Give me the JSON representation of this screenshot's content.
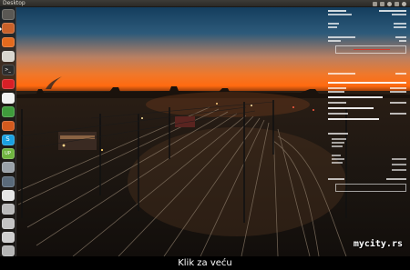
{
  "top_panel": {
    "title": "Desktop"
  },
  "launcher": {
    "icons": [
      {
        "name": "dash-home-icon",
        "glyph": "",
        "color": "#5a5854"
      },
      {
        "name": "files-icon",
        "glyph": "",
        "color": "#c8612a"
      },
      {
        "name": "firefox-icon",
        "glyph": "",
        "color": "#e36a1e"
      },
      {
        "name": "text-editor-icon",
        "glyph": "",
        "color": "#d9d6cf"
      },
      {
        "name": "terminal-icon",
        "glyph": ">_",
        "color": "#2c2c2c"
      },
      {
        "name": "opera-icon",
        "glyph": "",
        "color": "#d81f26"
      },
      {
        "name": "libreoffice-writer-icon",
        "glyph": "",
        "color": "#f2f2f2"
      },
      {
        "name": "libreoffice-calc-icon",
        "glyph": "",
        "color": "#3f9b3c"
      },
      {
        "name": "libreoffice-impress-icon",
        "glyph": "",
        "color": "#d35a1e"
      },
      {
        "name": "skype-icon",
        "glyph": "S",
        "color": "#1aa0e0"
      },
      {
        "name": "upwork-icon",
        "glyph": "UP",
        "color": "#6fb43f"
      },
      {
        "name": "system-settings-icon",
        "glyph": "",
        "color": "#9aa1a8"
      },
      {
        "name": "workspace-switcher-icon",
        "glyph": "",
        "color": "#5a6a7a"
      },
      {
        "name": "dvd-drive-icon",
        "glyph": "",
        "color": "#e5e5e5"
      },
      {
        "name": "usb-drive-icon",
        "glyph": "",
        "color": "#b9b9b9"
      },
      {
        "name": "hard-drive-icon",
        "glyph": "",
        "color": "#c4c4c4"
      },
      {
        "name": "removable-drive-icon",
        "glyph": "",
        "color": "#cfcfcf"
      },
      {
        "name": "trash-icon",
        "glyph": "",
        "color": "#b5b5b5"
      }
    ]
  },
  "watermark": "mycity.rs",
  "caption": "Klik za veću"
}
